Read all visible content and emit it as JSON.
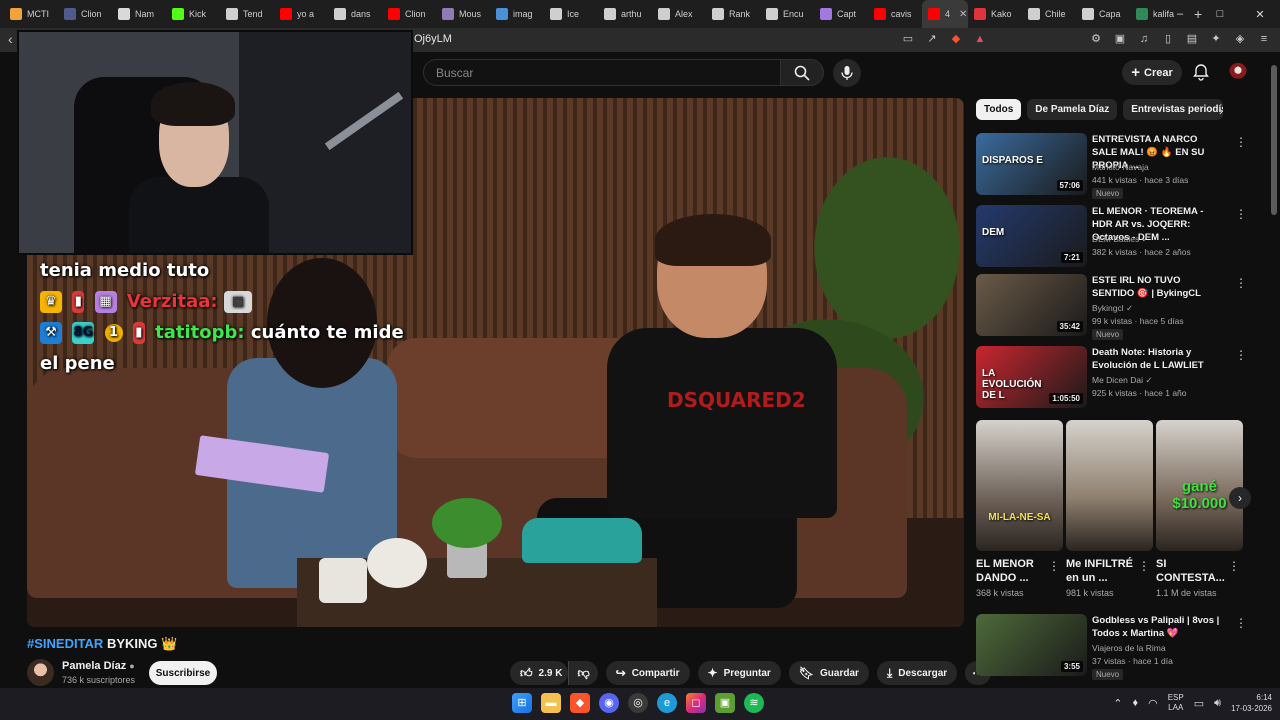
{
  "browser": {
    "tabs": [
      {
        "label": "MCTI",
        "color": "#f2a33a"
      },
      {
        "label": "Clion",
        "color": "#4e5b8c"
      },
      {
        "label": "Nam",
        "color": "#d9d9d9"
      },
      {
        "label": "Kick",
        "color": "#53fc18"
      },
      {
        "label": "Tend",
        "color": "#cfcfcf"
      },
      {
        "label": "yo a",
        "color": "#ff0000"
      },
      {
        "label": "dans",
        "color": "#cfcfcf"
      },
      {
        "label": "Clion",
        "color": "#ff0000"
      },
      {
        "label": "Mous",
        "color": "#8e7ab5"
      },
      {
        "label": "imag",
        "color": "#4a90d9"
      },
      {
        "label": "Ice",
        "color": "#cfcfcf"
      },
      {
        "label": "arthu",
        "color": "#cfcfcf"
      },
      {
        "label": "Alex",
        "color": "#cfcfcf"
      },
      {
        "label": "Rank",
        "color": "#cfcfcf"
      },
      {
        "label": "Encu",
        "color": "#cfcfcf"
      },
      {
        "label": "Capt",
        "color": "#a377e0"
      },
      {
        "label": "cavis",
        "color": "#ff0000"
      },
      {
        "label": "4",
        "color": "#ff0000",
        "active": true
      },
      {
        "label": "Kako",
        "color": "#e2323b"
      },
      {
        "label": "Chile",
        "color": "#cfcfcf"
      },
      {
        "label": "Capa",
        "color": "#cfcfcf"
      },
      {
        "label": "kalifa",
        "color": "#2e8b57"
      }
    ],
    "url_fragment": "Oj6yLM",
    "window_controls": [
      "–",
      "□",
      "✕"
    ]
  },
  "header": {
    "search_placeholder": "Buscar",
    "create_label": "Crear"
  },
  "video": {
    "chat": [
      {
        "text": "tenia medio tuto"
      },
      {
        "user": "Verzitaa:",
        "user_color": "#e8343a"
      },
      {
        "user": "tatitopb:",
        "user_color": "#3ee84a",
        "text": "cuánto te mide"
      },
      {
        "text": "el pene"
      }
    ],
    "shirt_text": "DSQUARED2",
    "title_hash": "#SINEDITAR",
    "title_rest": "BYKING",
    "title_emoji": "👑",
    "channel_name": "Pamela Díaz",
    "channel_subs": "736 k suscriptores",
    "subscribe_label": "Suscribirse",
    "likes": "2.9 K",
    "share_label": "Compartir",
    "ask_label": "Preguntar",
    "save_label": "Guardar",
    "download_label": "Descargar"
  },
  "sidebar": {
    "chips": [
      "Todos",
      "De Pamela Díaz",
      "Entrevistas periodísti"
    ],
    "recommendations": [
      {
        "title": "ENTREVISTA A NARCO SALE MAL! 😡 🔥 EN SU PROPIA ...",
        "channel": "Markito Navaja",
        "meta": "441 k vistas · hace 3 días",
        "duration": "57:06",
        "badge": "Nuevo",
        "thumb_text": "DISPAROS E",
        "thumb_color": "#3a6b9e"
      },
      {
        "title": "EL MENOR · TEOREMA - HDR AR vs. JOQERR: Octavos - DEM ...",
        "channel": "DEM Battles ✓",
        "meta": "382 k vistas · hace 2 años",
        "duration": "7:21",
        "badge": "",
        "thumb_text": "DEM",
        "thumb_color": "#243a6e"
      },
      {
        "title": "ESTE IRL NO TUVO SENTIDO 🎯 | BykingCL",
        "channel": "Bykingcl ✓",
        "meta": "99 k vistas · hace 5 días",
        "duration": "35:42",
        "badge": "Nuevo",
        "thumb_text": "",
        "thumb_color": "#6b5a48"
      },
      {
        "title": "Death Note: Historia y Evolución de L LAWLIET",
        "channel": "Me Dicen Dai ✓",
        "meta": "925 k vistas · hace 1 año",
        "duration": "1:05:50",
        "badge": "",
        "thumb_text": "LA EVOLUCIÓN DE L",
        "thumb_color": "#c9262f"
      }
    ],
    "shorts": [
      {
        "title": "EL MENOR DANDO ...",
        "views": "368 k vistas",
        "caption": "MI-LA-NE-SA",
        "caption_color": "#f5e050",
        "bg": "#6e6258"
      },
      {
        "title": "Me INFILTRÉ en un ...",
        "views": "981 k vistas",
        "caption": "",
        "caption_color": "#ffffff",
        "bg": "#8e7f6e"
      },
      {
        "title": "SI CONTESTA...",
        "views": "1.1 M de vistas",
        "caption": "gané $10.000",
        "caption_color": "#3fe03f",
        "bg": "#7a6a5c"
      }
    ],
    "bottom_rec": {
      "title": "Godbless vs Palipali | 8vos | Todos x Martina 💖",
      "channel": "Viajeros de la Rima",
      "meta": "37 vistas · hace 1 día",
      "duration": "3:55",
      "badge": "Nuevo",
      "thumb_color": "#4e6a3a"
    }
  },
  "taskbar": {
    "lang_top": "ESP",
    "lang_bottom": "LAA",
    "time": "6:14",
    "date": "17-03-2026"
  }
}
